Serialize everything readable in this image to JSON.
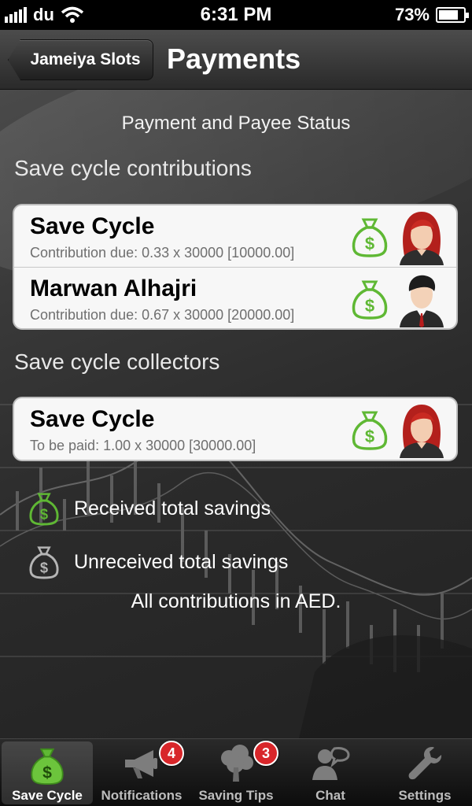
{
  "status_bar": {
    "carrier": "du",
    "time": "6:31 PM",
    "battery": "73%"
  },
  "navbar": {
    "back_label": "Jameiya Slots",
    "title": "Payments"
  },
  "subtitle": "Payment and Payee Status",
  "contributions": {
    "heading": "Save cycle contributions",
    "rows": [
      {
        "name": "Save Cycle",
        "detail": "Contribution due: 0.33 x 30000 [10000.00]",
        "status": "received",
        "avatar": "female-avatar"
      },
      {
        "name": "Marwan Alhajri",
        "detail": "Contribution due: 0.67 x 30000 [20000.00]",
        "status": "received",
        "avatar": "male-avatar"
      }
    ]
  },
  "collectors": {
    "heading": "Save cycle collectors",
    "rows": [
      {
        "name": "Save Cycle",
        "detail": "To be paid: 1.00 x 30000 [30000.00]",
        "status": "received",
        "avatar": "female-avatar"
      }
    ]
  },
  "legend": {
    "received": "Received total savings",
    "unreceived": "Unreceived total savings"
  },
  "currency_note": "All contributions in AED.",
  "colors": {
    "received": "#5fb834",
    "unreceived": "#b5b5b5"
  },
  "tabs": [
    {
      "label": "Save Cycle",
      "icon": "money-bag-icon",
      "active": true,
      "badge": ""
    },
    {
      "label": "Notifications",
      "icon": "megaphone-icon",
      "active": false,
      "badge": "4"
    },
    {
      "label": "Saving Tips",
      "icon": "tree-icon",
      "active": false,
      "badge": "3"
    },
    {
      "label": "Chat",
      "icon": "chat-icon",
      "active": false,
      "badge": ""
    },
    {
      "label": "Settings",
      "icon": "wrench-icon",
      "active": false,
      "badge": ""
    }
  ]
}
